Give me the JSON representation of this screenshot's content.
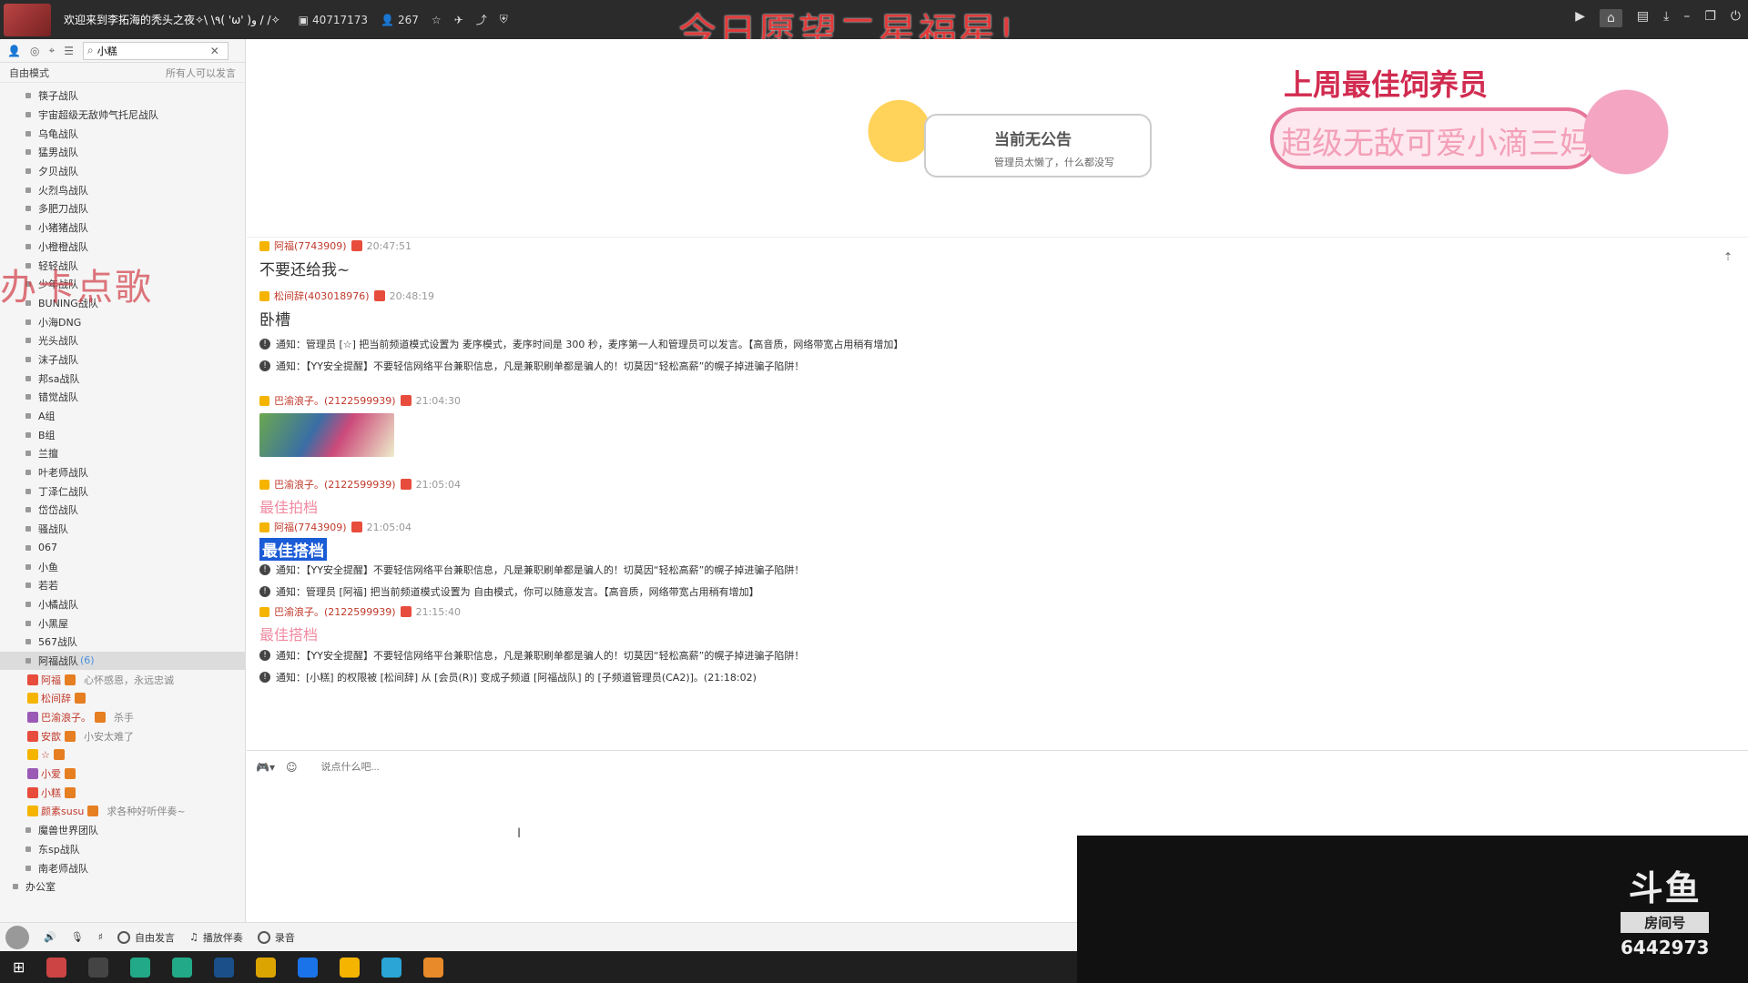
{
  "titlebar": {
    "channel_name": "欢迎来到李拓海的秃头之夜✧\\ \\٩( 'ω' )و / /✧",
    "channel_id": "40717173",
    "online_count": "267"
  },
  "banner": {
    "wish_text": "今日愿望二星福星!"
  },
  "sidebar": {
    "search_value": "小糕",
    "mode_label": "自由模式",
    "mode_hint": "所有人可以发言",
    "groups": [
      "筷子战队",
      "宇宙超级无敌帅气托尼战队",
      "乌龟战队",
      "猛男战队",
      "夕贝战队",
      "火烈鸟战队",
      "多肥刀战队",
      "小猪猪战队",
      "小橙橙战队",
      "轻轻战队",
      "少年战队",
      "BUNING战队",
      "小海DNG",
      "光头战队",
      "沫子战队",
      "邦sa战队",
      "错觉战队",
      "A组",
      "B组",
      "兰擅",
      "叶老师战队",
      "丁泽仁战队",
      "岱岱战队",
      "骚战队",
      "067",
      "小鱼",
      "若若",
      "小橘战队",
      "小黑屋",
      "567战队"
    ],
    "selected_group": "阿福战队",
    "selected_count": "(6)",
    "members": [
      {
        "name": "阿福",
        "signature": "心怀感恩，永远忠诚"
      },
      {
        "name": "松间辞",
        "signature": ""
      },
      {
        "name": "巴渝浪子。",
        "signature": "杀手"
      },
      {
        "name": "安歆",
        "signature": "小安太难了"
      },
      {
        "name": "☆",
        "signature": ""
      },
      {
        "name": "小爱",
        "signature": ""
      },
      {
        "name": "小糕",
        "signature": ""
      },
      {
        "name": "颜素susu",
        "signature": "求各种好听伴奏~"
      }
    ],
    "groups_after": [
      "魔兽世界团队",
      "东sp战队",
      "南老师战队"
    ],
    "root_after": "办公室"
  },
  "overlay": {
    "song_request": "办卡点歌"
  },
  "announcement": {
    "title": "当前无公告",
    "subtitle": "管理员太懒了，什么都没写"
  },
  "feeder": {
    "title": "上周最佳饲养员",
    "name": "超级无敌可爱小滴三妈"
  },
  "chat": {
    "messages": [
      {
        "user": "阿福(7743909)",
        "time": "20:47:51",
        "text": "不要还给我~"
      },
      {
        "user": "松间辞(403018976)",
        "time": "20:48:19",
        "text": "卧槽"
      },
      {
        "notice": "通知：管理员 [☆] 把当前频道模式设置为 麦序模式，麦序时间是 300 秒，麦序第一人和管理员可以发言。【高音质，网络带宽占用稍有增加】"
      },
      {
        "notice": "通知：【YY安全提醒】不要轻信网络平台兼职信息，凡是兼职刷单都是骗人的！切莫因“轻松高薪”的幌子掉进骗子陷阱！"
      },
      {
        "user": "巴渝浪子。(2122599939)",
        "time": "21:04:30",
        "image": true
      },
      {
        "user": "巴渝浪子。(2122599939)",
        "time": "21:05:04",
        "text": "最佳拍档"
      },
      {
        "user": "阿福(7743909)",
        "time": "21:05:04",
        "text": "最佳搭档"
      },
      {
        "notice": "通知：【YY安全提醒】不要轻信网络平台兼职信息，凡是兼职刷单都是骗人的！切莫因“轻松高薪”的幌子掉进骗子陷阱！"
      },
      {
        "notice": "通知：管理员 [阿福] 把当前频道模式设置为 自由模式，你可以随意发言。【高音质，网络带宽占用稍有增加】"
      },
      {
        "user": "巴渝浪子。(2122599939)",
        "time": "21:15:40",
        "text": "最佳搭档"
      },
      {
        "notice": "通知：【YY安全提醒】不要轻信网络平台兼职信息，凡是兼职刷单都是骗人的！切莫因“轻松高薪”的幌子掉进骗子陷阱！"
      },
      {
        "notice": "通知：[小糕] 的权限被 [松间辞] 从 [会员(R)] 变成子频道 [阿福战队] 的 [子频道管理员(CA2)]。(21:18:02)"
      }
    ]
  },
  "input": {
    "placeholder": "说点什么吧..."
  },
  "bottombar": {
    "free_speak": "自由发言",
    "play_music": "播放伴奏",
    "record": "录音"
  },
  "douyu": {
    "logo": "斗鱼",
    "room_label": "房间号",
    "room_number": "6442973"
  }
}
